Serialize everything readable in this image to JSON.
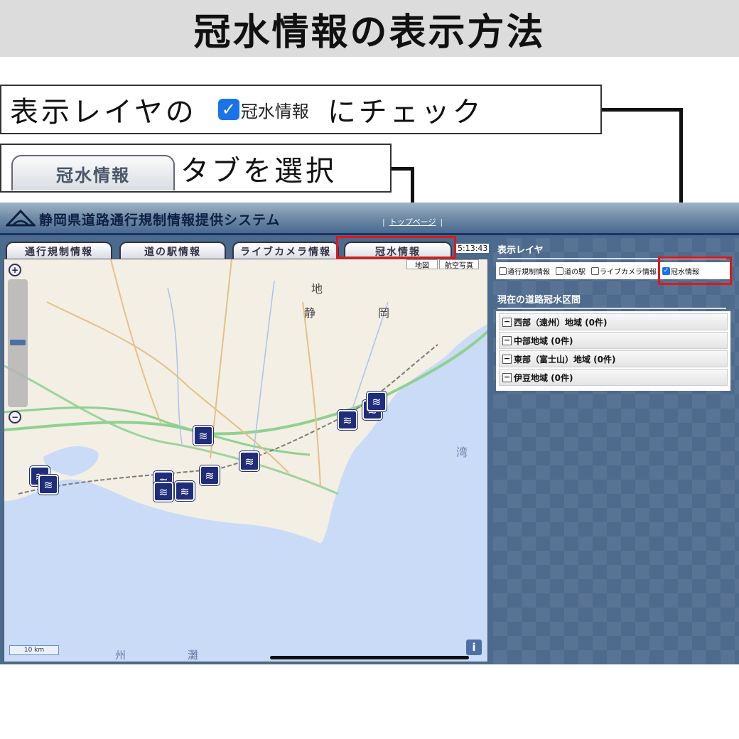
{
  "banner": {
    "title": "冠水情報の表示方法"
  },
  "instructions": {
    "step1_prefix": "表示レイヤの",
    "step1_checkbox_label": "冠水情報",
    "step1_suffix": "にチェック",
    "step2_tab_label": "冠水情報",
    "step2_suffix": "タブを選択"
  },
  "app": {
    "title": "静岡県道路通行規制情報提供システム",
    "top_link": "トップページ",
    "time": "5:13:43",
    "tabs": [
      "通行規制情報",
      "道の駅情報",
      "ライブカメラ情報",
      "冠水情報"
    ],
    "map": {
      "switch_map": "地図",
      "switch_aerial": "航空写真",
      "scale": "10 km",
      "info": "i",
      "zoom_in": "+",
      "zoom_out": "−",
      "place_labels": [
        "静",
        "岡",
        "地",
        "湾",
        "州",
        "灘"
      ]
    },
    "panel": {
      "layers_heading": "表示レイヤ",
      "layers": [
        {
          "label": "通行規制情報",
          "checked": false
        },
        {
          "label": "道の駅",
          "checked": false
        },
        {
          "label": "ライブカメラ情報",
          "checked": false
        },
        {
          "label": "冠水情報",
          "checked": true
        }
      ],
      "regions_heading": "現在の道路冠水区間",
      "regions": [
        "西部（遠州）地域 (0件)",
        "中部地域 (0件)",
        "東部（富士山）地域 (0件)",
        "伊豆地域 (0件)"
      ]
    }
  },
  "colors": {
    "accent_red": "#e01818",
    "checkbox_blue": "#1a73e8",
    "flood_icon": "#1f2d7a",
    "header_navy": "#1c3566",
    "sea": "#c9dbf6"
  },
  "icons": [
    "checkmark-icon",
    "flood-road-icon",
    "zoom-in-icon",
    "zoom-out-icon",
    "info-icon",
    "prefecture-logo-icon"
  ]
}
